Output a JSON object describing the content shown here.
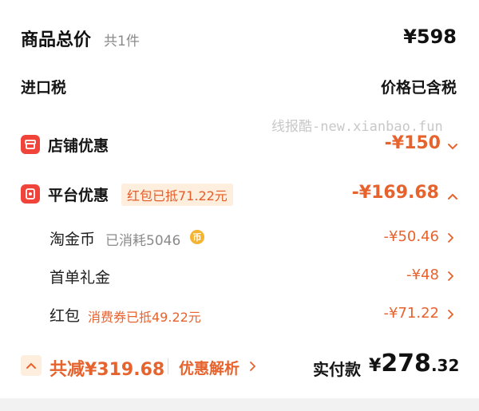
{
  "summary": {
    "title": "商品总价",
    "count": "共1件",
    "total": "¥598"
  },
  "tax": {
    "label": "进口税",
    "value": "价格已含税"
  },
  "watermark": "线报酷-new.xianbao.fun",
  "store_discount": {
    "label": "店铺优惠",
    "amount": "-¥150"
  },
  "platform_discount": {
    "label": "平台优惠",
    "tag": "红包已抵71.22元",
    "amount": "-¥169.68",
    "items": [
      {
        "label": "淘金币",
        "note": "已消耗5046",
        "coin_text": "币",
        "amount": "-¥50.46"
      },
      {
        "label": "首单礼金",
        "note": "",
        "amount": "-¥48"
      },
      {
        "label": "红包",
        "note": "消费券已抵49.22元",
        "amount": "-¥71.22"
      }
    ]
  },
  "footer": {
    "total_reduce": "共减¥319.68",
    "analysis": "优惠解析",
    "pay_label": "实付款",
    "pay_symbol": "¥",
    "pay_int": "278",
    "pay_dec": ".32"
  },
  "colors": {
    "accent": "#e8622d",
    "icon_red": "#f0433a",
    "tag_bg": "#fdeedd"
  }
}
